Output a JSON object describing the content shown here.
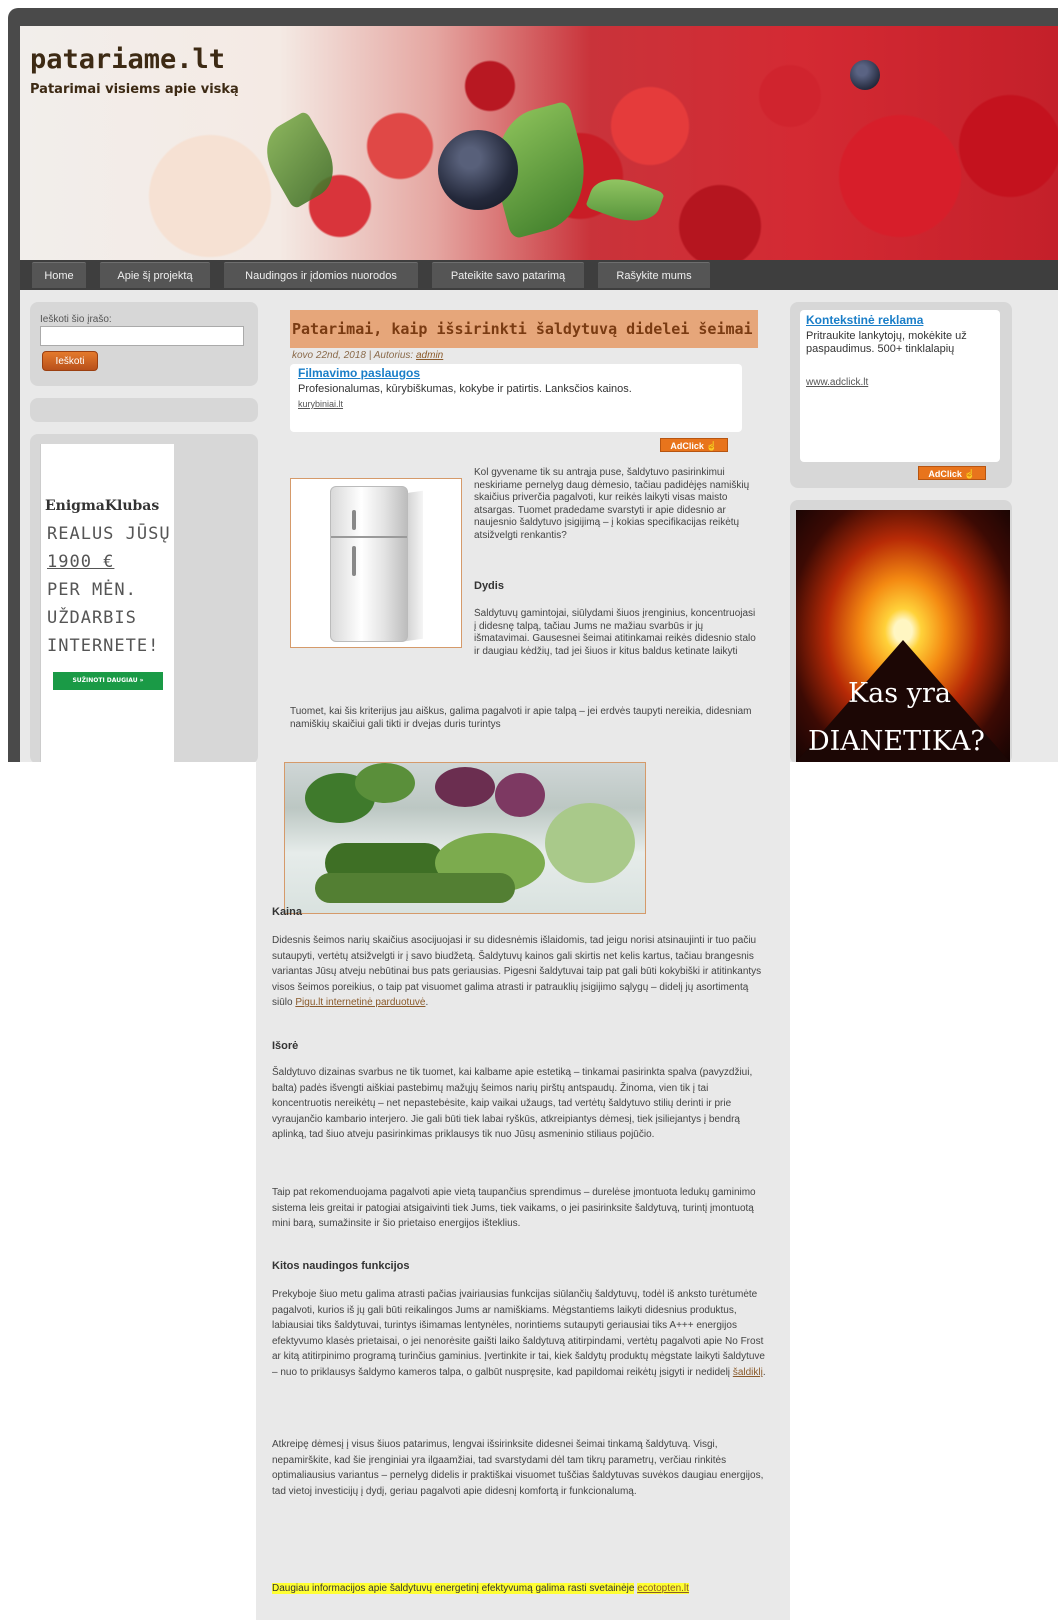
{
  "site": {
    "title": "patariame.lt",
    "tagline": "Patarimai visiems apie viską"
  },
  "nav": {
    "items": [
      {
        "label": "Home"
      },
      {
        "label": "Apie šį projektą"
      },
      {
        "label": "Naudingos ir įdomios nuorodos"
      },
      {
        "label": "Pateikite savo patarimą"
      },
      {
        "label": "Rašykite mums"
      }
    ]
  },
  "search": {
    "label": "Ieškoti šio įrašo:",
    "button": "Ieškoti",
    "value": ""
  },
  "ad_enigma": {
    "title": "EnigmaKlubas",
    "lines": [
      "REALUS JŪSŲ",
      "1900 €",
      "PER MĖN.",
      "UŽDARBIS",
      "INTERNETE!"
    ],
    "button": "SUŽINOTI DAUGIAU »"
  },
  "post": {
    "title": "Patarimai, kaip išsirinkti šaldytuvą didelei šeimai",
    "date": "kovo 22nd, 2018",
    "author_prefix": "Autorius:",
    "author": "admin",
    "intro": "Kol gyvename tik su antrąja puse, šaldytuvo pasirinkimui neskiriame pernelyg daug dėmesio, tačiau padidėjęs namiškių skaičius priverčia pagalvoti, kur reikės laikyti visas maisto atsargas. Tuomet pradedame svarstyti ir apie didesnio ar naujesnio šaldytuvo įsigijimą – į kokias specifikacijas reikėtų atsižvelgti renkantis?",
    "h_dydis": "Dydis",
    "dydis_text": "Šaldytuvų gamintojai, siūlydami šiuos įrenginius, koncentruojasi į didesnę talpą, tačiau Jums ne mažiau svarbūs ir jų išmatavimai. Gausesnei šeimai atitinkamai reikės didesnio stalo ir daugiau kėdžių, tad jei šiuos ir kitus baldus ketinate laikyti virtuvėje, turėtumėte žinoti, kiek vietos galėsite skirti šaldytuvui.",
    "tuomet_text": "Tuomet, kai šis kriterijus jau aiškus, galima pagalvoti ir apie talpą – jei erdvės taupyti nereikia, didesniam namiškių skaičiui gali tikti ir dvejas duris turintys",
    "h_kaina": "Kaina",
    "kaina_text": "Didesnis šeimos narių skaičius asocijuojasi ir su didesnėmis išlaidomis, tad jeigu norisi atsinaujinti ir tuo pačiu sutaupyti, vertėtų atsižvelgti ir į savo biudžetą. Šaldytuvų kainos gali skirtis net kelis kartus, tačiau brangesnis variantas Jūsų atveju nebūtinai bus pats geriausias. Pigesni šaldytuvai taip pat gali būti kokybiški ir atitinkantys visos šeimos poreikius, o taip pat visuomet galima atrasti ir patrauklių įsigijimo sąlygų – didelį jų asortimentą siūlo",
    "kaina_link": "Pigu.lt internetinė parduotuvė",
    "h_isore": "Išorė",
    "isore_text": "Šaldytuvo dizainas svarbus ne tik tuomet, kai kalbame apie estetiką – tinkamai pasirinkta spalva (pavyzdžiui, balta) padės išvengti aiškiai pastebimų mažųjų šeimos narių pirštų antspaudų. Žinoma, vien tik į tai koncentruotis nereikėtų – net nepastebėsite, kaip vaikai užaugs, tad vertėtų šaldytuvo stilių derinti ir prie vyraujančio kambario interjero. Jie gali būti tiek labai ryškūs, atkreipiantys dėmesį, tiek įsiliejantys į bendrą aplinką, tad šiuo atveju pasirinkimas priklausys tik nuo Jūsų asmeninio stiliaus pojūčio.",
    "taip_text": "Taip pat rekomenduojama pagalvoti apie vietą taupančius sprendimus – durelėse įmontuota ledukų gaminimo sistema leis greitai ir patogiai atsigaivinti tiek Jums, tiek vaikams, o jei pasirinksite šaldytuvą, turintį įmontuotą mini barą, sumažinsite ir šio prietaiso energijos išteklius.",
    "h_kitos": "Kitos naudingos funkcijos",
    "kitos_text": "Prekyboje šiuo metu galima atrasti pačias įvairiausias funkcijas siūlančių šaldytuvų, todėl iš anksto turėtumėte pagalvoti, kurios iš jų gali būti reikalingos Jums ar namiškiams. Mėgstantiems laikyti didesnius produktus, labiausiai tiks šaldytuvai, turintys išimamas lentynėles, norintiems sutaupyti geriausiai tiks A+++ energijos efektyvumo klasės prietaisai, o jei nenorėsite gaišti laiko šaldytuvą atitirpindami, vertėtų pagalvoti apie No Frost ar kitą atitirpinimo programą turinčius gaminius. Įvertinkite ir tai, kiek šaldytų produktų mėgstate laikyti šaldytuve – nuo to priklausys šaldymo kameros talpa, o galbūt nuspręsite, kad papildomai reikėtų įsigyti ir nedidelį",
    "kitos_link": "šaldiklį",
    "atkreipe_text": "Atkreipę dėmesį į visus šiuos patarimus, lengvai išsirinksite didesnei šeimai tinkamą šaldytuvą. Visgi, nepamirškite, kad šie įrenginiai yra ilgaamžiai, tad svarstydami dėl tam tikrų parametrų, verčiau rinkitės optimaliausius variantus – pernelyg didelis ir praktiškai visuomet tuščias šaldytuvas suvėkos daugiau energijos, tad vietoj investicijų į dydį, geriau pagalvoti apie didesnį komfortą ir funkcionalumą.",
    "highlight_text": "Daugiau informacijos apie šaldytuvų energetinį efektyvumą galima rasti svetainėje",
    "highlight_link": "ecotopten.lt"
  },
  "ad_film": {
    "title": "Filmavimo paslaugos",
    "text": "Profesionalumas, kūrybiškumas, kokybe ir patirtis. Lanksčios kainos.",
    "url": "kurybiniai.lt",
    "badge": "AdClick"
  },
  "ad_kontekst": {
    "title": "Kontekstinė reklama",
    "text": "Pritraukite lankytojų, mokėkite už paspaudimus. 500+ tinklalapių",
    "url": "www.adclick.lt",
    "badge": "AdClick"
  },
  "ad_volcano": {
    "line1": "Kas yra",
    "line2": "DIANETIKA?"
  },
  "colors": {
    "accent": "#e8741c",
    "title_bar": "#e6a67a",
    "link": "#1a7ec8",
    "highlight": "#ffff33"
  }
}
